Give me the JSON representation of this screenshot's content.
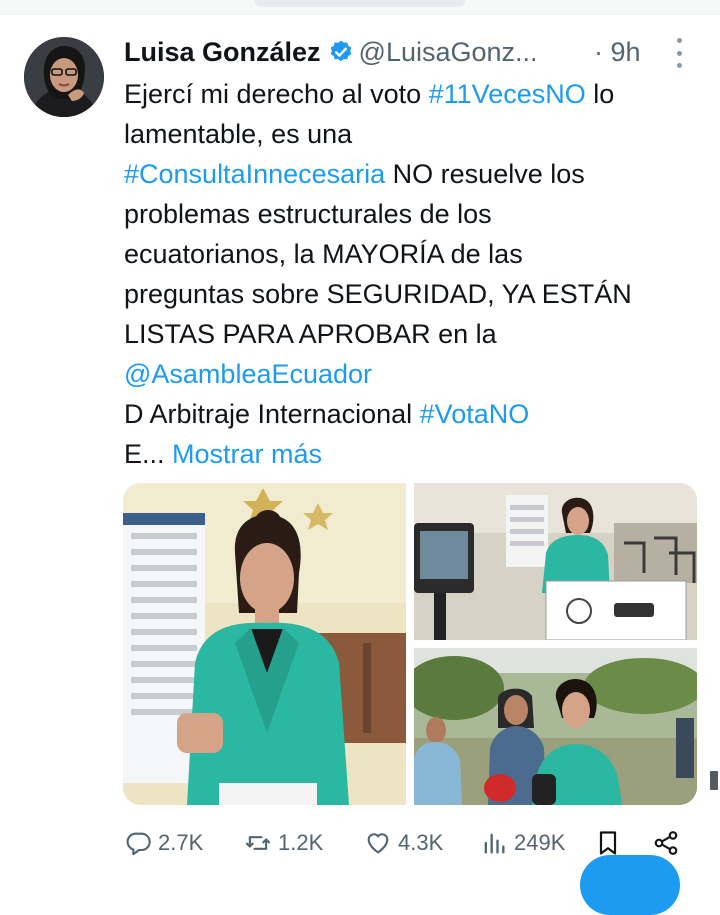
{
  "tweet": {
    "author_name": "Luisa González",
    "author_handle": "@LuisaGonz...",
    "time": "· 9h",
    "text_lines": [
      [
        {
          "t": "Ejercí mi derecho al voto "
        },
        {
          "t": "#11VecesNO",
          "link": true
        },
        {
          "t": " lo"
        }
      ],
      [
        {
          "t": "lamentable, es una"
        }
      ],
      [
        {
          "t": "#ConsultaInnecesaria",
          "link": true
        },
        {
          "t": " NO resuelve los"
        }
      ],
      [
        {
          "t": "problemas estructurales de los"
        }
      ],
      [
        {
          "t": "ecuatorianos, la MAYORÍA de las"
        }
      ],
      [
        {
          "t": "preguntas sobre SEGURIDAD, YA ESTÁN"
        }
      ],
      [
        {
          "t": "LISTAS PARA APROBAR en la"
        }
      ],
      [
        {
          "t": "@AsambleaEcuador",
          "link": true
        }
      ],
      [
        {
          "t": "D Arbitraje Internacional "
        },
        {
          "t": "#VotaNO",
          "link": true
        }
      ],
      [
        {
          "t": "E... "
        },
        {
          "t": "Mostrar más",
          "link": true
        }
      ]
    ]
  },
  "actions": {
    "replies": "2.7K",
    "reposts": "1.2K",
    "likes": "4.3K",
    "views": "249K"
  },
  "colors": {
    "link": "#1d9bf0",
    "secondary_text": "#536471",
    "verified": "#1d9bf0"
  },
  "icons": [
    "verified-badge-icon",
    "more-options-icon",
    "reply-icon",
    "repost-icon",
    "like-icon",
    "views-icon",
    "bookmark-icon",
    "share-icon"
  ]
}
